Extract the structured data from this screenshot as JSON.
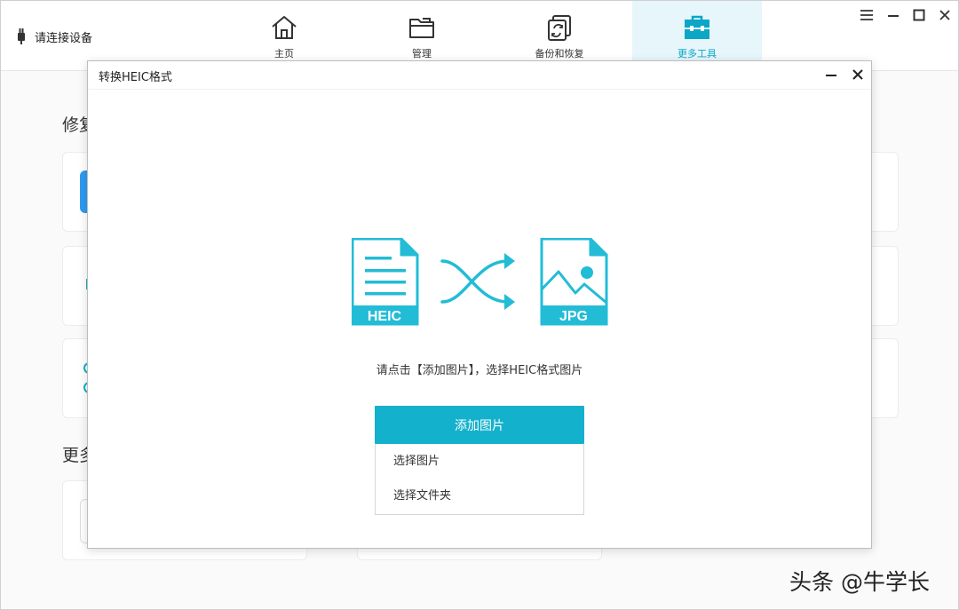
{
  "header": {
    "device_status": "请连接设备",
    "tabs": [
      {
        "label": "主页",
        "icon": "home-icon"
      },
      {
        "label": "管理",
        "icon": "folder-icon"
      },
      {
        "label": "备份和恢复",
        "icon": "backup-restore-icon"
      },
      {
        "label": "更多工具",
        "icon": "toolbox-icon",
        "active": true
      }
    ],
    "window_controls": [
      "menu-icon",
      "minimize-icon",
      "maximize-icon",
      "close-icon"
    ]
  },
  "background": {
    "section1_title_partial": "修复",
    "section2_title_partial": "更多"
  },
  "dialog": {
    "title": "转换HEIC格式",
    "source_format": "HEIC",
    "target_format": "JPG",
    "hint": "请点击【添加图片】，选择HEIC格式图片",
    "add_button": "添加图片",
    "dropdown_items": [
      "选择图片",
      "选择文件夹"
    ]
  },
  "watermark": "头条 @牛学长",
  "colors": {
    "accent": "#14b1cc",
    "icon_teal": "#22bcd6",
    "active_tab_bg": "#e6f6fb"
  }
}
